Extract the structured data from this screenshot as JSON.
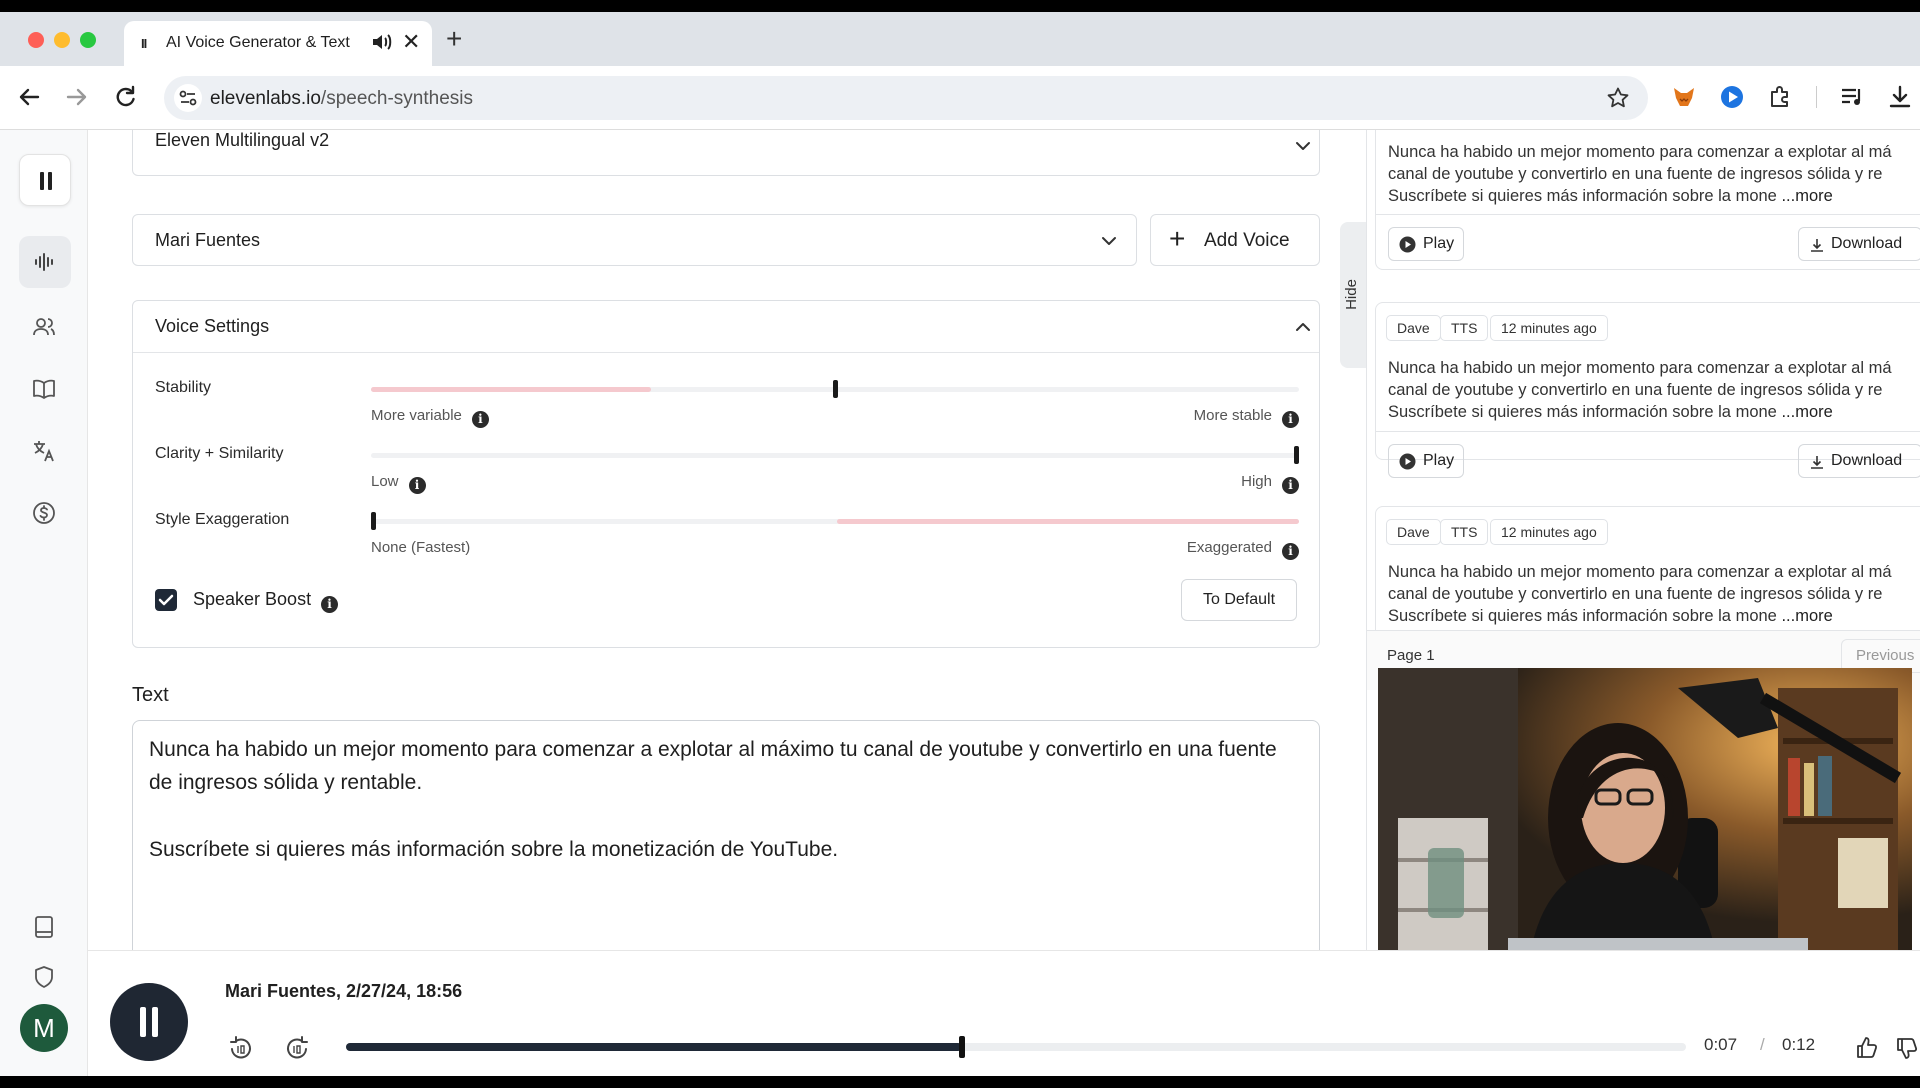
{
  "browser": {
    "tab_title": "AI Voice Generator & Text",
    "tab_playing_glyph": "II",
    "new_tab_glyph": "+",
    "close_glyph": "✕",
    "url_domain": "elevenlabs.io",
    "url_path": "/speech-synthesis"
  },
  "form": {
    "model": "Eleven Multilingual v2",
    "voice": "Mari Fuentes",
    "add_voice": "Add Voice",
    "add_voice_glyph": "+"
  },
  "voice_settings": {
    "title": "Voice Settings",
    "info_glyph": "i",
    "sliders": [
      {
        "label": "Stability",
        "left": "More variable",
        "right": "More stable",
        "value": 0.5
      },
      {
        "label": "Clarity + Similarity",
        "left": "Low",
        "right": "High",
        "value": 1.0
      },
      {
        "label": "Style Exaggeration",
        "left": "None (Fastest)",
        "right": "Exaggerated",
        "value": 0.0
      }
    ],
    "speaker_boost": "Speaker Boost",
    "speaker_boost_checked": true,
    "to_default": "To Default"
  },
  "text": {
    "label": "Text",
    "para1": "Nunca ha habido un mejor momento para comenzar a explotar al máximo tu canal de youtube y convertirlo en una fuente de ingresos sólida y rentable.",
    "para2": "Suscríbete si quieres más información sobre la monetización de YouTube."
  },
  "history": {
    "hide_label": "Hide",
    "items": [
      {
        "line1": "Nunca ha habido un mejor momento para comenzar a explotar al má",
        "line2": "canal de youtube y convertirlo en una fuente de ingresos sólida y re",
        "line3": "Suscríbete si quieres más información sobre la mone",
        "more": "...more",
        "play": "Play",
        "download": "Download"
      },
      {
        "user": "Dave",
        "kind": "TTS",
        "time": "12 minutes ago",
        "line1": "Nunca ha habido un mejor momento para comenzar a explotar al má",
        "line2": "canal de youtube y convertirlo en una fuente de ingresos sólida y re",
        "line3": "Suscríbete si quieres más información sobre la mone",
        "more": "...more",
        "play": "Play",
        "download": "Download"
      },
      {
        "user": "Dave",
        "kind": "TTS",
        "time": "12 minutes ago",
        "line1": "Nunca ha habido un mejor momento para comenzar a explotar al má",
        "line2": "canal de youtube y convertirlo en una fuente de ingresos sólida y re",
        "line3": "Suscríbete si quieres más información sobre la mone",
        "more": "...more"
      }
    ],
    "page_label": "Page 1",
    "previous": "Previous"
  },
  "player": {
    "title": "Mari Fuentes, 2/27/24, 18:56",
    "current": "0:07",
    "separator": "/",
    "duration": "0:12",
    "progress": 0.46
  },
  "user": {
    "avatar_initial": "M"
  },
  "colors": {
    "accent_dark": "#1f2937",
    "slider_fill": "#f5c9ce",
    "avatar_bg": "#1e5a3c"
  }
}
